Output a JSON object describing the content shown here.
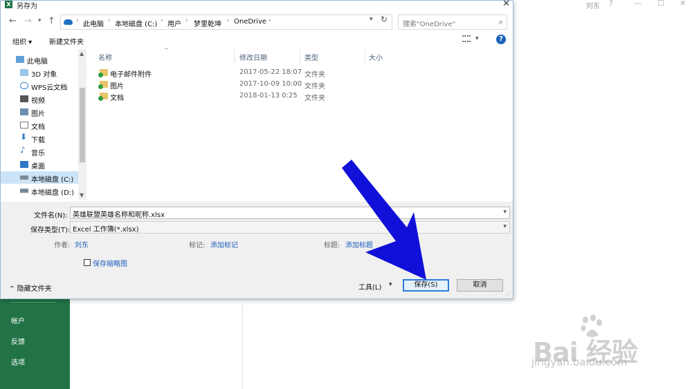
{
  "colors": {
    "excel_green": "#217346",
    "arrow_blue": "#1010d8",
    "link_blue": "#1f5fbf"
  },
  "excel": {
    "user_name": "刘东",
    "help_glyph": "?",
    "side_nav": [
      "帐户",
      "反馈",
      "选项"
    ]
  },
  "dialog": {
    "title": "另存为",
    "app_icon_letter": "X",
    "close_glyph": "✕",
    "breadcrumbs": [
      "此电脑",
      "本地磁盘 (C:)",
      "用户",
      "梦里乾坤",
      "OneDrive"
    ],
    "search_placeholder": "搜索\"OneDrive\"",
    "toolbar": {
      "organize_label": "组织 ▾",
      "new_folder_label": "新建文件夹",
      "help_glyph": "?"
    },
    "nav_items": [
      {
        "label": "此电脑",
        "icon": "computer-icon"
      },
      {
        "label": "3D 对象",
        "icon": "3d-objects-icon"
      },
      {
        "label": "WPS云文档",
        "icon": "cloud-icon"
      },
      {
        "label": "视频",
        "icon": "video-icon"
      },
      {
        "label": "图片",
        "icon": "pictures-icon"
      },
      {
        "label": "文档",
        "icon": "documents-icon"
      },
      {
        "label": "下载",
        "icon": "download-icon"
      },
      {
        "label": "音乐",
        "icon": "music-icon"
      },
      {
        "label": "桌面",
        "icon": "desktop-icon"
      },
      {
        "label": "本地磁盘 (C:)",
        "icon": "drive-icon"
      },
      {
        "label": "本地磁盘 (D:)",
        "icon": "drive-icon"
      }
    ],
    "columns": {
      "name": "名称",
      "date": "修改日期",
      "type": "类型",
      "size": "大小"
    },
    "files": [
      {
        "name": "电子邮件附件",
        "date": "2017-05-22 18:07",
        "type": "文件夹"
      },
      {
        "name": "图片",
        "date": "2017-10-09 10:00",
        "type": "文件夹"
      },
      {
        "name": "文档",
        "date": "2018-01-13 0:25",
        "type": "文件夹"
      }
    ],
    "filename_label": "文件名(N):",
    "filename_value": "英雄联盟英雄名称和昵称.xlsx",
    "filetype_label": "保存类型(T):",
    "filetype_value": "Excel 工作簿(*.xlsx)",
    "author_label": "作者:",
    "author_value": "刘东",
    "tags_label": "标记:",
    "tags_value": "添加标记",
    "subject_label": "标题:",
    "subject_value": "添加标题",
    "thumbnail_label": "保存缩略图",
    "hide_folders_label": "隐藏文件夹",
    "tools_label": "工具(L)",
    "save_label": "保存(S)",
    "cancel_label": "取消"
  },
  "watermark": {
    "brand": "Bai  经验",
    "url": "jingyan.baidu.com"
  }
}
